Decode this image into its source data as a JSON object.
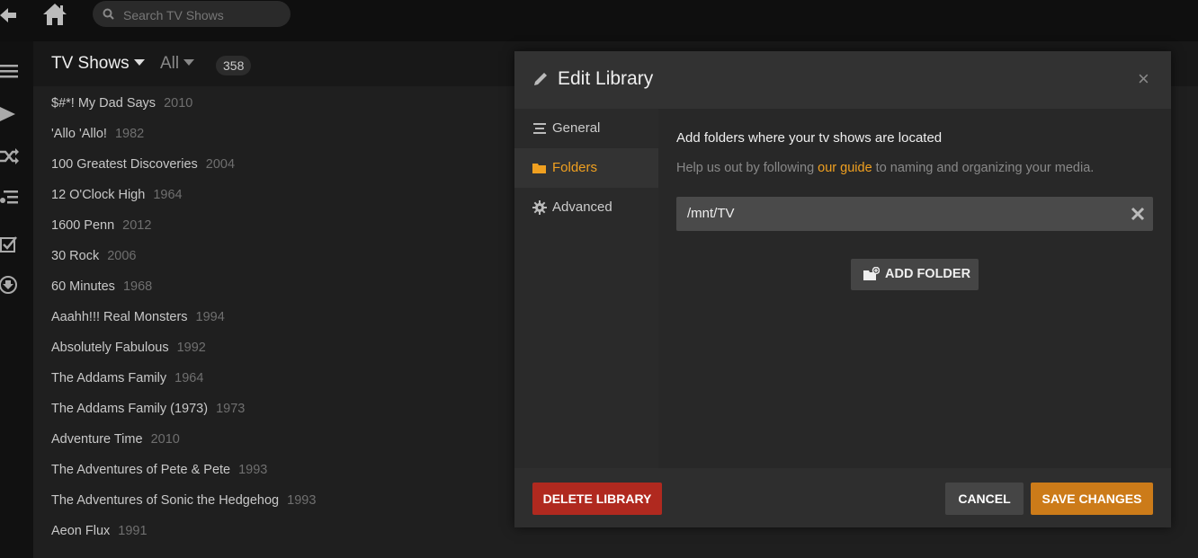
{
  "topbar": {
    "search_placeholder": "Search TV Shows"
  },
  "library": {
    "title": "TV Shows",
    "filter": "All",
    "count": "358",
    "shows": [
      {
        "title": "$#*! My Dad Says",
        "year": "2010"
      },
      {
        "title": "'Allo 'Allo!",
        "year": "1982"
      },
      {
        "title": "100 Greatest Discoveries",
        "year": "2004"
      },
      {
        "title": "12 O'Clock High",
        "year": "1964"
      },
      {
        "title": "1600 Penn",
        "year": "2012"
      },
      {
        "title": "30 Rock",
        "year": "2006"
      },
      {
        "title": "60 Minutes",
        "year": "1968"
      },
      {
        "title": "Aaahh!!! Real Monsters",
        "year": "1994"
      },
      {
        "title": "Absolutely Fabulous",
        "year": "1992"
      },
      {
        "title": "The Addams Family",
        "year": "1964"
      },
      {
        "title": "The Addams Family (1973)",
        "year": "1973"
      },
      {
        "title": "Adventure Time",
        "year": "2010"
      },
      {
        "title": "The Adventures of Pete & Pete",
        "year": "1993"
      },
      {
        "title": "The Adventures of Sonic the Hedgehog",
        "year": "1993"
      },
      {
        "title": "Aeon Flux",
        "year": "1991"
      }
    ]
  },
  "modal": {
    "title": "Edit Library",
    "close_glyph": "×",
    "nav": [
      {
        "label": "General",
        "icon": "list-icon"
      },
      {
        "label": "Folders",
        "icon": "folder-icon",
        "active": true
      },
      {
        "label": "Advanced",
        "icon": "gear-icon"
      }
    ],
    "content": {
      "heading": "Add folders where your tv shows are located",
      "help_prefix": "Help us out by following ",
      "help_link": "our guide",
      "help_suffix": " to naming and organizing your media.",
      "folders": [
        "/mnt/TV"
      ],
      "add_folder_label": "ADD FOLDER"
    },
    "footer": {
      "delete_label": "DELETE LIBRARY",
      "cancel_label": "CANCEL",
      "save_label": "SAVE CHANGES"
    }
  },
  "colors": {
    "accent": "#f0a020",
    "delete": "#b0291f",
    "save": "#cc7b19"
  }
}
